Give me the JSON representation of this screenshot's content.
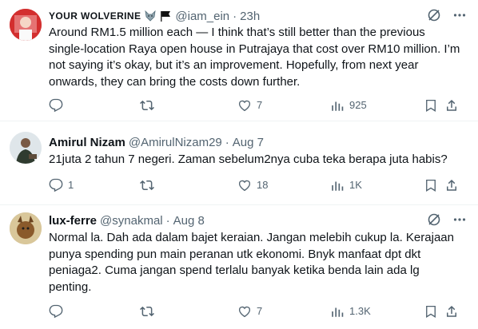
{
  "posts": [
    {
      "display_name": "YOUR WOLVERINE",
      "emoji": [
        "wolf-emoji",
        "black-flag-emoji"
      ],
      "handle": "@iam_ein",
      "time": "23h",
      "text": "Around RM1.5 million each — I think that’s still better than the previous single-location Raya open house in Putrajaya that cost over RM10 million. I’m not saying it’s okay, but it’s an improvement. Hopefully, from next year onwards, they can bring the costs down further.",
      "replies": "",
      "reposts": "",
      "likes": "7",
      "views": "925"
    },
    {
      "display_name": "Amirul Nizam",
      "handle": "@AmirulNizam29",
      "time": "Aug 7",
      "text": "21juta 2 tahun 7 negeri. Zaman sebelum2nya cuba teka berapa juta habis?",
      "replies": "1",
      "reposts": "",
      "likes": "18",
      "views": "1K"
    },
    {
      "display_name": "lux-ferre",
      "handle": "@synakmal",
      "time": "Aug 8",
      "text": "Normal la. Dah ada dalam bajet keraian. Jangan melebih cukup la. Kerajaan punya spending pun main peranan utk ekonomi. Bnyk manfaat dpt dkt peniaga2. Cuma jangan spend terlalu banyak ketika benda lain ada lg penting.",
      "replies": "",
      "reposts": "",
      "likes": "7",
      "views": "1.3K"
    }
  ],
  "dot_separator": "·",
  "colors": {
    "text": "#0f1419",
    "secondary": "#536471",
    "divider": "#eff3f4"
  }
}
